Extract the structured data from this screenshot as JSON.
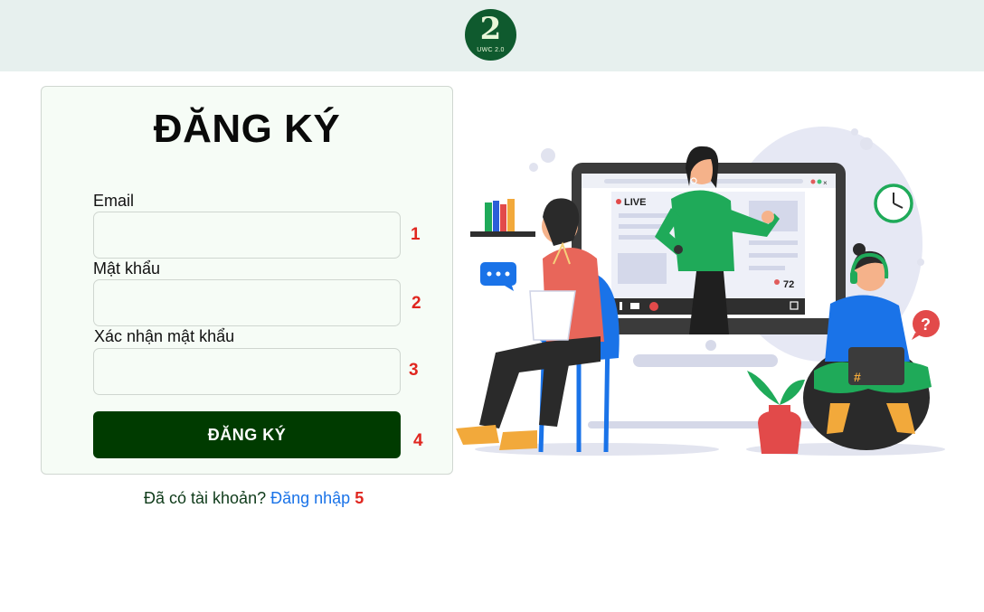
{
  "header": {
    "logo_number": "2",
    "logo_text": "UWC 2.0"
  },
  "form": {
    "title": "ĐĂNG KÝ",
    "email_label": "Email",
    "email_value": "",
    "password_label": "Mật khẩu",
    "password_value": "",
    "confirm_label": "Xác nhận mật khẩu",
    "confirm_value": "",
    "submit_label": "ĐĂNG KÝ"
  },
  "footer": {
    "prompt": "Đã có tài khoản? ",
    "login_link": "Đăng nhập"
  },
  "annotations": [
    "1",
    "2",
    "3",
    "4",
    "5"
  ],
  "illustration": {
    "live_label": "LIVE",
    "viewer_count": "72",
    "icons": [
      "person-on-screen",
      "man-with-laptop",
      "woman-with-headset",
      "clock-icon",
      "question-icon",
      "chat-bubble-icon",
      "plant-pot",
      "bookshelf"
    ]
  },
  "colors": {
    "header_bg": "#e7f0ee",
    "card_bg": "#f6fcf6",
    "button_bg": "#003b00",
    "link": "#1a73e8",
    "annotation": "#e0261f",
    "logo_bg": "#0f5a2e"
  }
}
